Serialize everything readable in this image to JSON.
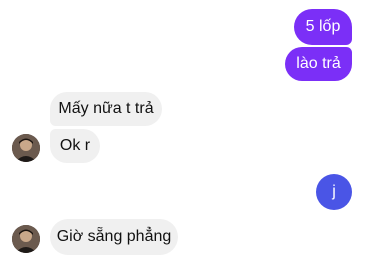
{
  "conversation": {
    "outgoing": [
      {
        "text": "5 lốp"
      },
      {
        "text": "lào trả"
      },
      {
        "text": "j"
      }
    ],
    "incoming": [
      {
        "text": "Mấy nữa t trả"
      },
      {
        "text": "Ok r"
      },
      {
        "text": "Giờ sẵng phẳng"
      }
    ],
    "colors": {
      "outgoing_bubble": "#7b2ff7",
      "outgoing_bubble_alt": "#4a55e6",
      "incoming_bubble": "#f0f0f0",
      "background": "#ffffff"
    },
    "icons": {
      "contact_avatar": "person-avatar-icon"
    }
  }
}
